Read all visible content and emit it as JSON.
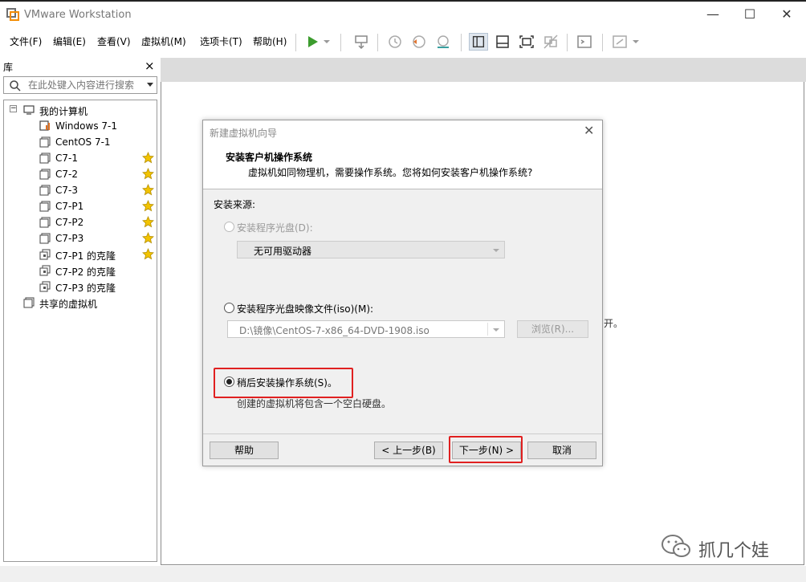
{
  "window": {
    "title": "VMware Workstation",
    "minimize": "—",
    "maximize": "☐",
    "close": "✕"
  },
  "menu": {
    "items": [
      "文件(F)",
      "编辑(E)",
      "查看(V)",
      "虚拟机(M)",
      "选项卡(T)",
      "帮助(H)"
    ]
  },
  "library": {
    "title": "库",
    "close": "×",
    "search_placeholder": "在此处键入内容进行搜索",
    "tree": [
      {
        "label": "我的计算机",
        "type": "computer",
        "starred": false
      },
      {
        "label": "Windows 7-1",
        "type": "vm-running",
        "starred": false
      },
      {
        "label": "CentOS 7-1",
        "type": "vm",
        "starred": false
      },
      {
        "label": "C7-1",
        "type": "vm",
        "starred": true
      },
      {
        "label": "C7-2",
        "type": "vm",
        "starred": true
      },
      {
        "label": "C7-3",
        "type": "vm",
        "starred": true
      },
      {
        "label": "C7-P1",
        "type": "vm",
        "starred": true
      },
      {
        "label": "C7-P2",
        "type": "vm",
        "starred": true
      },
      {
        "label": "C7-P3",
        "type": "vm",
        "starred": true
      },
      {
        "label": "C7-P1 的克隆",
        "type": "clone",
        "starred": true
      },
      {
        "label": "C7-P2 的克隆",
        "type": "clone",
        "starred": false
      },
      {
        "label": "C7-P3 的克隆",
        "type": "clone",
        "starred": false
      },
      {
        "label": "共享的虚拟机",
        "type": "shared",
        "starred": false
      }
    ]
  },
  "background": {
    "clipped_text": "开。"
  },
  "watermark": {
    "text": "抓几个娃"
  },
  "dialog": {
    "title": "新建虚拟机向导",
    "close": "✕",
    "heading": "安装客户机操作系统",
    "subheading": "虚拟机如同物理机，需要操作系统。您将如何安装客户机操作系统?",
    "source_label": "安装来源:",
    "option_disc": "安装程序光盘(D):",
    "disc_value": "无可用驱动器",
    "option_iso": "安装程序光盘映像文件(iso)(M):",
    "iso_value": "D:\\镜像\\CentOS-7-x86_64-DVD-1908.iso",
    "browse": "浏览(R)...",
    "option_later": "稍后安装操作系统(S)。",
    "later_note": "创建的虚拟机将包含一个空白硬盘。",
    "buttons": {
      "help": "帮助",
      "back": "< 上一步(B)",
      "next": "下一步(N) >",
      "cancel": "取消"
    },
    "selected_option": "later"
  },
  "colors": {
    "highlight": "#e02020",
    "star": "#f2c300",
    "play": "#3c9c2e"
  }
}
